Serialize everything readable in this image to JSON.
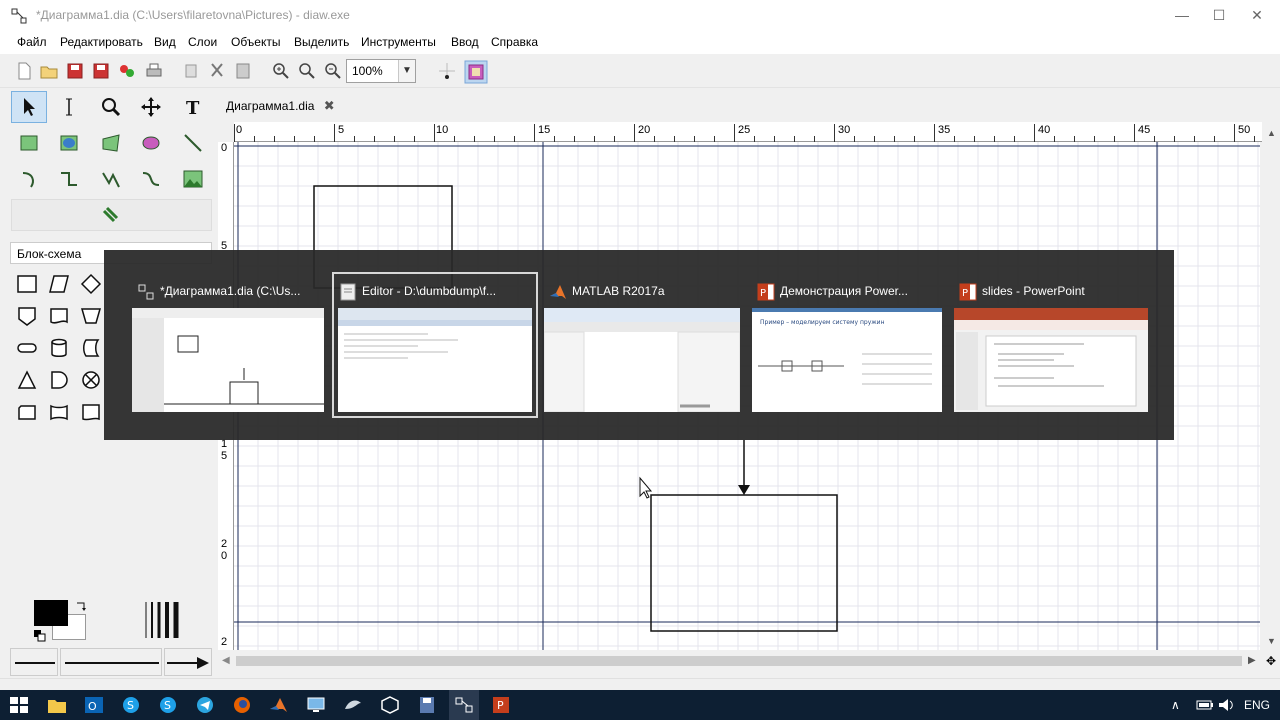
{
  "window": {
    "title": "*Диаграмма1.dia (C:\\Users\\filaretovna\\Pictures) - diaw.exe",
    "minimize": "—",
    "maximize": "☐",
    "close": "✕"
  },
  "menu": [
    "Файл",
    "Редактировать",
    "Вид",
    "Слои",
    "Объекты",
    "Выделить",
    "Инструменты",
    "Ввод",
    "Справка"
  ],
  "toolbar": {
    "zoom": "100%"
  },
  "tab": {
    "label": "Диаграмма1.dia",
    "close": "✖"
  },
  "sheet": {
    "selected": "Блок-схема"
  },
  "ruler": {
    "top_ticks": [
      "0",
      "5",
      "10",
      "15",
      "20",
      "25",
      "30",
      "35",
      "40",
      "45",
      "50"
    ],
    "left_ticks": [
      "0",
      "5",
      "1",
      "5",
      "2",
      "0",
      "2"
    ]
  },
  "switcher": [
    {
      "title": "*Диаграмма1.dia (C:\\Us...",
      "app": "dia"
    },
    {
      "title": "Editor - D:\\dumbdump\\f...",
      "app": "editor"
    },
    {
      "title": "MATLAB R2017a",
      "app": "matlab"
    },
    {
      "title": "Демонстрация Power...",
      "app": "powerpoint"
    },
    {
      "title": "slides - PowerPoint",
      "app": "powerpoint"
    }
  ],
  "thumb_text": {
    "pp_demo": "Пример – моделируем систему пружин"
  },
  "taskbar": {
    "lang": "ENG"
  },
  "colors": {
    "accent": "#0d1f33",
    "grid_major": "#1a2a5a",
    "grid_minor": "#e2e2ea"
  }
}
